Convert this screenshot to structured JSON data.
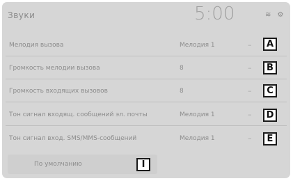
{
  "header": {
    "title": "Звуки",
    "clock": "5:00",
    "status_icons": "≋ ⚙"
  },
  "settings": [
    {
      "label": "Мелодия вызова",
      "value": "Мелодия 1",
      "marker": "A"
    },
    {
      "label": "Громкость мелодии вызова",
      "value": "8",
      "marker": "B"
    },
    {
      "label": "Громкость входящих вызовов",
      "value": "8",
      "marker": "C"
    },
    {
      "label": "Тон сигнал входящ. сообщений эл. почты",
      "value": "Мелодия 1",
      "marker": "D"
    },
    {
      "label": "Тон сигнал вход. SMS/MMS-сообщений",
      "value": "Мелодия 1",
      "marker": "E"
    }
  ],
  "footer": {
    "default_label": "По умолчанию",
    "marker": "I"
  }
}
